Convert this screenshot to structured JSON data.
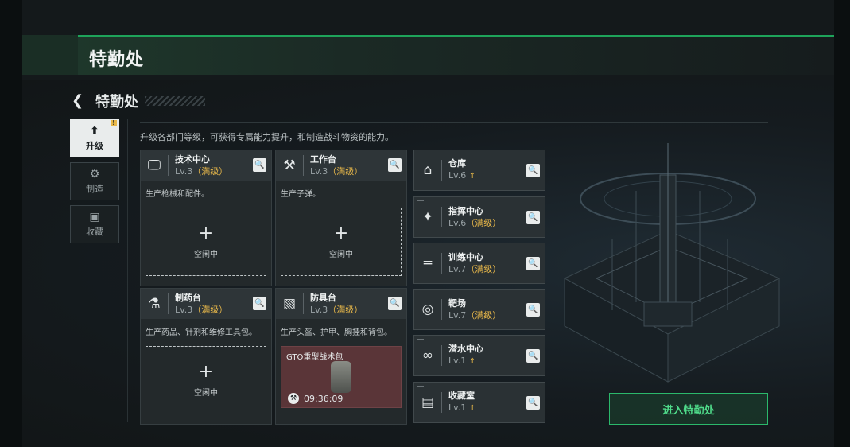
{
  "header": {
    "title": "特勤处"
  },
  "page": {
    "title": "特勤处",
    "description": "升级各部门等级，可获得专属能力提升，和制造战斗物资的能力。"
  },
  "side_tabs": [
    {
      "label": "升级",
      "icon": "upgrade-icon",
      "active": true,
      "badge": "!"
    },
    {
      "label": "制造",
      "icon": "gears-icon",
      "active": false
    },
    {
      "label": "收藏",
      "icon": "collection-icon",
      "active": false
    }
  ],
  "facilities": [
    {
      "name": "技术中心",
      "level": "Lv.3",
      "status": "（满级）",
      "desc": "生产枪械和配件。",
      "slot_plus": "+",
      "slot_status": "空闲中",
      "icon": "monitor-icon"
    },
    {
      "name": "工作台",
      "level": "Lv.3",
      "status": "（满级）",
      "desc": "生产子弹。",
      "slot_plus": "+",
      "slot_status": "空闲中",
      "icon": "tools-icon"
    },
    {
      "name": "制药台",
      "level": "Lv.3",
      "status": "（满级）",
      "desc": "生产药品、针剂和维修工具包。",
      "slot_plus": "+",
      "slot_status": "空闲中",
      "icon": "microscope-icon"
    },
    {
      "name": "防具台",
      "level": "Lv.3",
      "status": "（满级）",
      "desc": "生产头盔、护甲、胸挂和背包。",
      "busy_item": "GTO重型战术包",
      "busy_timer": "09:36:09",
      "icon": "armor-icon"
    }
  ],
  "small_facilities": [
    {
      "name": "仓库",
      "level": "Lv.6",
      "status": "",
      "upgrade": "⇑",
      "icon": "warehouse-icon"
    },
    {
      "name": "指挥中心",
      "level": "Lv.6",
      "status": "（满级）",
      "upgrade": "",
      "icon": "command-icon"
    },
    {
      "name": "训练中心",
      "level": "Lv.7",
      "status": "（满级）",
      "upgrade": "",
      "icon": "dumbbell-icon"
    },
    {
      "name": "靶场",
      "level": "Lv.7",
      "status": "（满级）",
      "upgrade": "",
      "icon": "target-icon"
    },
    {
      "name": "潜水中心",
      "level": "Lv.1",
      "status": "",
      "upgrade": "⇑",
      "icon": "diving-mask-icon"
    },
    {
      "name": "收藏室",
      "level": "Lv.1",
      "status": "",
      "upgrade": "⇑",
      "icon": "collection-room-icon"
    }
  ],
  "enter_button": {
    "label": "进入特勤处"
  },
  "colors": {
    "accent_green": "#2bb86b",
    "gold": "#e8b84a",
    "busy_red": "#5a3538"
  }
}
